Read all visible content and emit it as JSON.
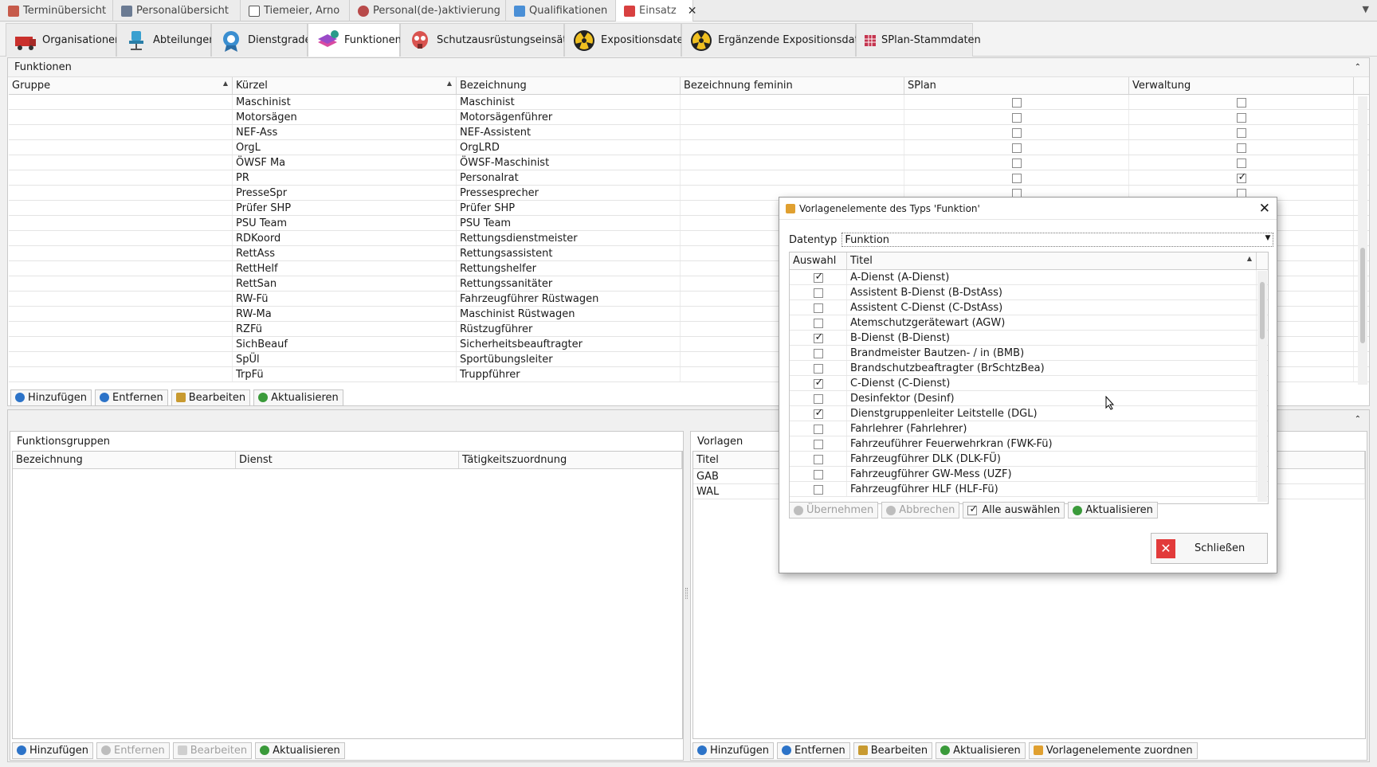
{
  "doc_tabs": [
    {
      "label": "Terminübersicht",
      "icon": "calendar-icon"
    },
    {
      "label": "Personalübersicht",
      "icon": "people-icon"
    },
    {
      "label": "Tiemeier, Arno",
      "icon": "id-card-icon"
    },
    {
      "label": "Personal(de-)aktivierung",
      "icon": "person-icon"
    },
    {
      "label": "Qualifikationen",
      "icon": "cube-icon"
    },
    {
      "label": "Einsatz",
      "icon": "fire-icon",
      "active": true
    }
  ],
  "ribbon_tabs": [
    {
      "label": "Organisationen",
      "icon": "firetruck-icon"
    },
    {
      "label": "Abteilungen",
      "icon": "office-chair-icon"
    },
    {
      "label": "Dienstgrade",
      "icon": "badge-icon"
    },
    {
      "label": "Funktionen",
      "icon": "stack-check-icon",
      "active": true
    },
    {
      "label": "Schutzausrüstungseinsätze",
      "icon": "gas-mask-icon"
    },
    {
      "label": "Expositionsdaten",
      "icon": "radiation-icon"
    },
    {
      "label": "Ergänzende Expositionsdaten",
      "icon": "radiation-icon"
    },
    {
      "label": "SPlan-Stammdaten",
      "icon": "grid-icon"
    }
  ],
  "funktionen": {
    "title": "Funktionen",
    "columns": [
      "Gruppe",
      "Kürzel",
      "Bezeichnung",
      "Bezeichnung feminin",
      "SPlan",
      "Verwaltung"
    ],
    "rows": [
      {
        "k": "Maschinist",
        "b": "Maschinist",
        "s": false,
        "v": false
      },
      {
        "k": "Motorsägen",
        "b": "Motorsägenführer",
        "s": false,
        "v": false
      },
      {
        "k": "NEF-Ass",
        "b": "NEF-Assistent",
        "s": false,
        "v": false
      },
      {
        "k": "OrgL",
        "b": "OrgLRD",
        "s": false,
        "v": false
      },
      {
        "k": "ÖWSF Ma",
        "b": "ÖWSF-Maschinist",
        "s": false,
        "v": false
      },
      {
        "k": "PR",
        "b": "Personalrat",
        "s": false,
        "v": true
      },
      {
        "k": "PresseSpr",
        "b": "Pressesprecher",
        "s": false,
        "v": false
      },
      {
        "k": "Prüfer SHP",
        "b": "Prüfer SHP"
      },
      {
        "k": "PSU Team",
        "b": "PSU Team"
      },
      {
        "k": "RDKoord",
        "b": "Rettungsdienstmeister"
      },
      {
        "k": "RettAss",
        "b": "Rettungsassistent"
      },
      {
        "k": "RettHelf",
        "b": "Rettungshelfer"
      },
      {
        "k": "RettSan",
        "b": "Rettungssanitäter"
      },
      {
        "k": "RW-Fü",
        "b": "Fahrzeugführer Rüstwagen"
      },
      {
        "k": "RW-Ma",
        "b": "Maschinist Rüstwagen"
      },
      {
        "k": "RZFü",
        "b": "Rüstzugführer"
      },
      {
        "k": "SichBeauf",
        "b": "Sicherheitsbeauftragter"
      },
      {
        "k": "SpÜl",
        "b": "Sportübungsleiter"
      },
      {
        "k": "TrpFü",
        "b": "Truppführer"
      }
    ],
    "buttons": [
      "Hinzufügen",
      "Entfernen",
      "Bearbeiten",
      "Aktualisieren"
    ]
  },
  "funktionsgruppen": {
    "title": "Funktionsgruppen",
    "columns": [
      "Bezeichnung",
      "Dienst",
      "Tätigkeitszuordnung"
    ],
    "buttons": [
      "Hinzufügen",
      "Entfernen",
      "Bearbeiten",
      "Aktualisieren"
    ]
  },
  "vorlagen": {
    "title": "Vorlagen",
    "column": "Titel",
    "rows": [
      "GAB",
      "WAL"
    ],
    "buttons": [
      "Hinzufügen",
      "Entfernen",
      "Bearbeiten",
      "Aktualisieren",
      "Vorlagenelemente zuordnen"
    ]
  },
  "dialog": {
    "title": "Vorlagenelemente des Typs 'Funktion'",
    "datentyp_label": "Datentyp",
    "datentyp_value": "Funktion",
    "columns": [
      "Auswahl",
      "Titel"
    ],
    "items": [
      {
        "t": "A-Dienst (A-Dienst)",
        "c": true
      },
      {
        "t": "Assistent B-Dienst (B-DstAss)",
        "c": false
      },
      {
        "t": "Assistent C-Dienst (C-DstAss)",
        "c": false
      },
      {
        "t": "Atemschutzgerätewart (AGW)",
        "c": false
      },
      {
        "t": "B-Dienst (B-Dienst)",
        "c": true
      },
      {
        "t": "Brandmeister Bautzen- / in (BMB)",
        "c": false
      },
      {
        "t": "Brandschutzbeaftragter (BrSchtzBea)",
        "c": false
      },
      {
        "t": "C-Dienst (C-Dienst)",
        "c": true
      },
      {
        "t": "Desinfektor (Desinf)",
        "c": false
      },
      {
        "t": "Dienstgruppenleiter Leitstelle (DGL)",
        "c": true
      },
      {
        "t": "Fahrlehrer (Fahrlehrer)",
        "c": false
      },
      {
        "t": "Fahrzeuführer Feuerwehrkran (FWK-Fü)",
        "c": false
      },
      {
        "t": "Fahrzeugführer DLK (DLK-FÜ)",
        "c": false
      },
      {
        "t": "Fahrzeugführer GW-Mess (UZF)",
        "c": false
      },
      {
        "t": "Fahrzeugführer HLF (HLF-Fü)",
        "c": false
      }
    ],
    "buttons": [
      "Übernehmen",
      "Abbrechen",
      "Alle auswählen",
      "Aktualisieren"
    ],
    "close_label": "Schließen"
  },
  "colors": {
    "accent_blue": "#2c73c8",
    "green": "#3a9a3a",
    "red": "#e23b3b"
  }
}
